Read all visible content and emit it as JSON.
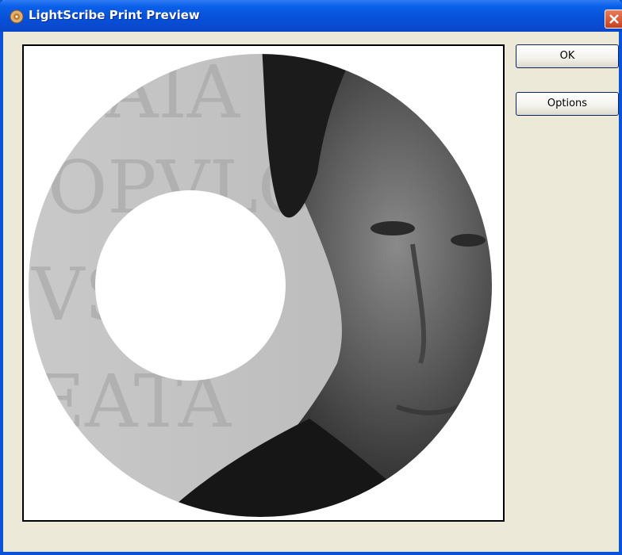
{
  "window": {
    "title": "LightScribe Print Preview"
  },
  "buttons": {
    "ok_label": "OK",
    "options_label": "Options"
  },
  "icons": {
    "app": "lightscribe-disc-icon",
    "close": "close-icon"
  },
  "colors": {
    "titlebar": "#0a53d6",
    "close_button": "#d9502c",
    "window_face": "#ece9d8"
  }
}
